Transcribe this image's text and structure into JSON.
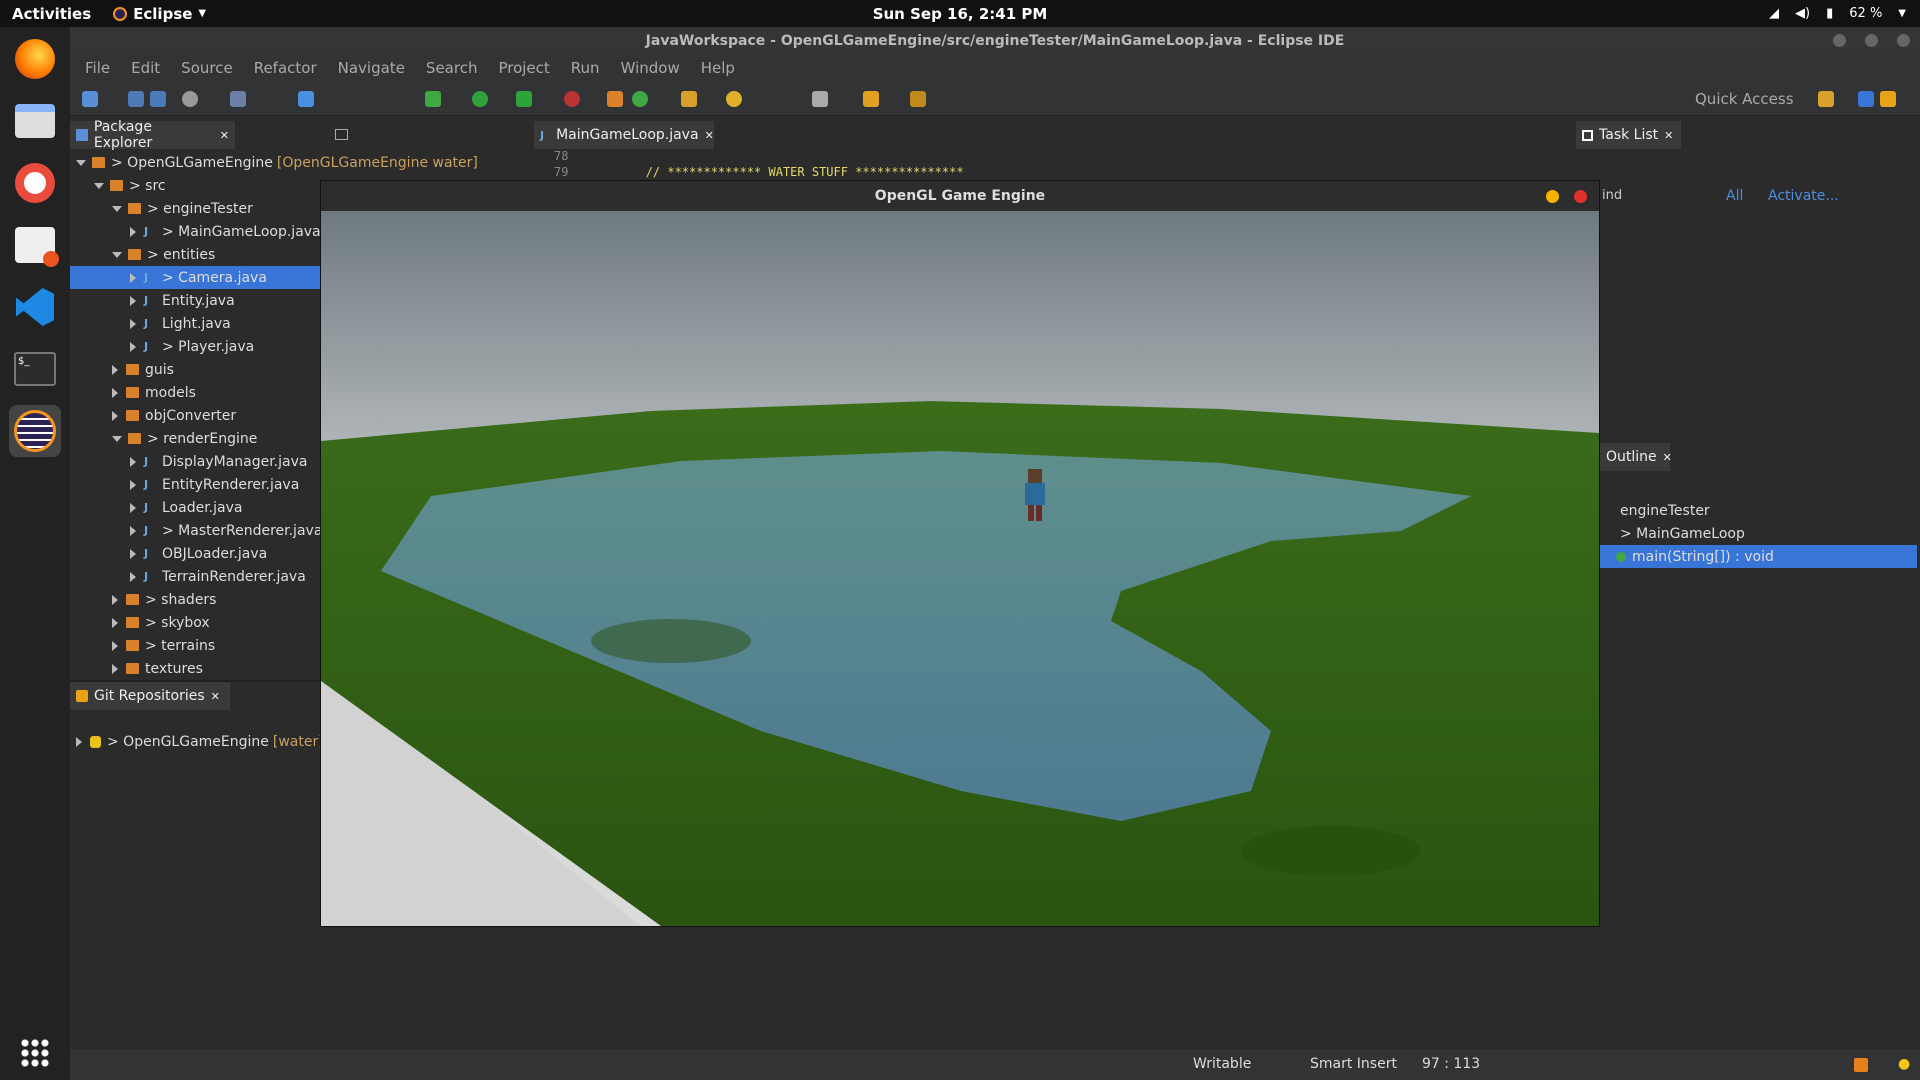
{
  "system": {
    "activities": "Activities",
    "app_name": "Eclipse",
    "clock": "Sun Sep 16,  2:41 PM",
    "battery": "62 %"
  },
  "window": {
    "title": "JavaWorkspace - OpenGLGameEngine/src/engineTester/MainGameLoop.java - Eclipse IDE"
  },
  "menu": [
    "File",
    "Edit",
    "Source",
    "Refactor",
    "Navigate",
    "Search",
    "Project",
    "Run",
    "Window",
    "Help"
  ],
  "toolbar": {
    "quick_access": "Quick Access"
  },
  "package_explorer": {
    "tab": "Package Explorer",
    "project": "> OpenGLGameEngine",
    "project_suffix": "[OpenGLGameEngine water]",
    "items": [
      {
        "label": "> src"
      },
      {
        "label": "> engineTester"
      },
      {
        "label": "> MainGameLoop.java"
      },
      {
        "label": "> entities"
      },
      {
        "label": "> Camera.java"
      },
      {
        "label": "Entity.java"
      },
      {
        "label": "Light.java"
      },
      {
        "label": "> Player.java"
      },
      {
        "label": "guis"
      },
      {
        "label": "models"
      },
      {
        "label": "objConverter"
      },
      {
        "label": "> renderEngine"
      },
      {
        "label": "DisplayManager.java"
      },
      {
        "label": "EntityRenderer.java"
      },
      {
        "label": "Loader.java"
      },
      {
        "label": "> MasterRenderer.java"
      },
      {
        "label": "OBJLoader.java"
      },
      {
        "label": "TerrainRenderer.java"
      },
      {
        "label": "> shaders"
      },
      {
        "label": "> skybox"
      },
      {
        "label": "> terrains"
      },
      {
        "label": "textures"
      }
    ]
  },
  "git": {
    "tab": "Git Repositories",
    "repo": "> OpenGLGameEngine",
    "repo_suffix": "[water] -"
  },
  "editor": {
    "tab": "MainGameLoop.java",
    "lines": [
      {
        "num": "78",
        "code": ""
      },
      {
        "num": "79",
        "code": "// ************* WATER STUFF ***************"
      }
    ]
  },
  "game_window": {
    "title": "OpenGL Game Engine"
  },
  "task_list": {
    "tab": "Task List",
    "find": "ind",
    "all": "All",
    "activate": "Activate..."
  },
  "outline": {
    "tab": "Outline",
    "items": [
      "engineTester",
      "> MainGameLoop",
      "main(String[]) : void"
    ]
  },
  "status": {
    "writable": "Writable",
    "insert": "Smart Insert",
    "position": "97 : 113"
  },
  "colors": {
    "accent": "#3875d7",
    "package": "#d9822b",
    "grass": "#3f7a1a",
    "water": "#4f7d8c"
  }
}
